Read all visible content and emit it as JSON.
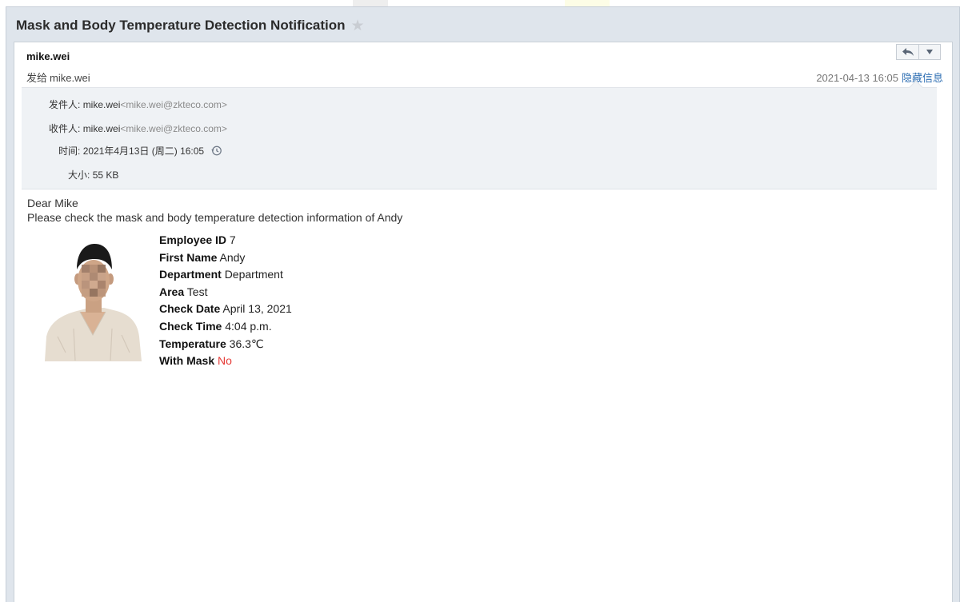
{
  "email": {
    "subject": "Mask and Body Temperature Detection Notification",
    "sender": "mike.wei",
    "sent_to_prefix": "发给",
    "sent_to_name": "mike.wei",
    "datetime": "2021-04-13 16:05",
    "hide_info_label": "隐藏信息"
  },
  "details": {
    "from_label": "发件人:",
    "from_name": "mike.wei",
    "from_addr": "<mike.wei@zkteco.com>",
    "to_label": "收件人:",
    "to_name": "mike.wei",
    "to_addr": "<mike.wei@zkteco.com>",
    "time_label": "时间:",
    "time_value": "2021年4月13日 (周二) 16:05",
    "size_label": "大小:",
    "size_value": "55 KB"
  },
  "body": {
    "greeting": "Dear Mike",
    "intro": "Please check the mask and body temperature detection information of Andy",
    "fields": [
      {
        "label": "Employee ID",
        "value": "7"
      },
      {
        "label": "First Name",
        "value": "Andy"
      },
      {
        "label": "Department",
        "value": "Department"
      },
      {
        "label": "Area",
        "value": "Test"
      },
      {
        "label": "Check Date",
        "value": "April 13, 2021"
      },
      {
        "label": "Check Time",
        "value": "4:04 p.m."
      },
      {
        "label": "Temperature ",
        "value": "36.3℃"
      },
      {
        "label": "With Mask ",
        "value": "No"
      }
    ]
  },
  "colors": {
    "header_bg": "#dfe5ec",
    "details_bg": "#eff2f5",
    "link_blue": "#2f6fb3",
    "alert_red": "#e53935"
  },
  "icons": {
    "star": "star-icon",
    "reply": "reply-icon",
    "more": "chevron-down-icon",
    "history": "history-icon"
  }
}
